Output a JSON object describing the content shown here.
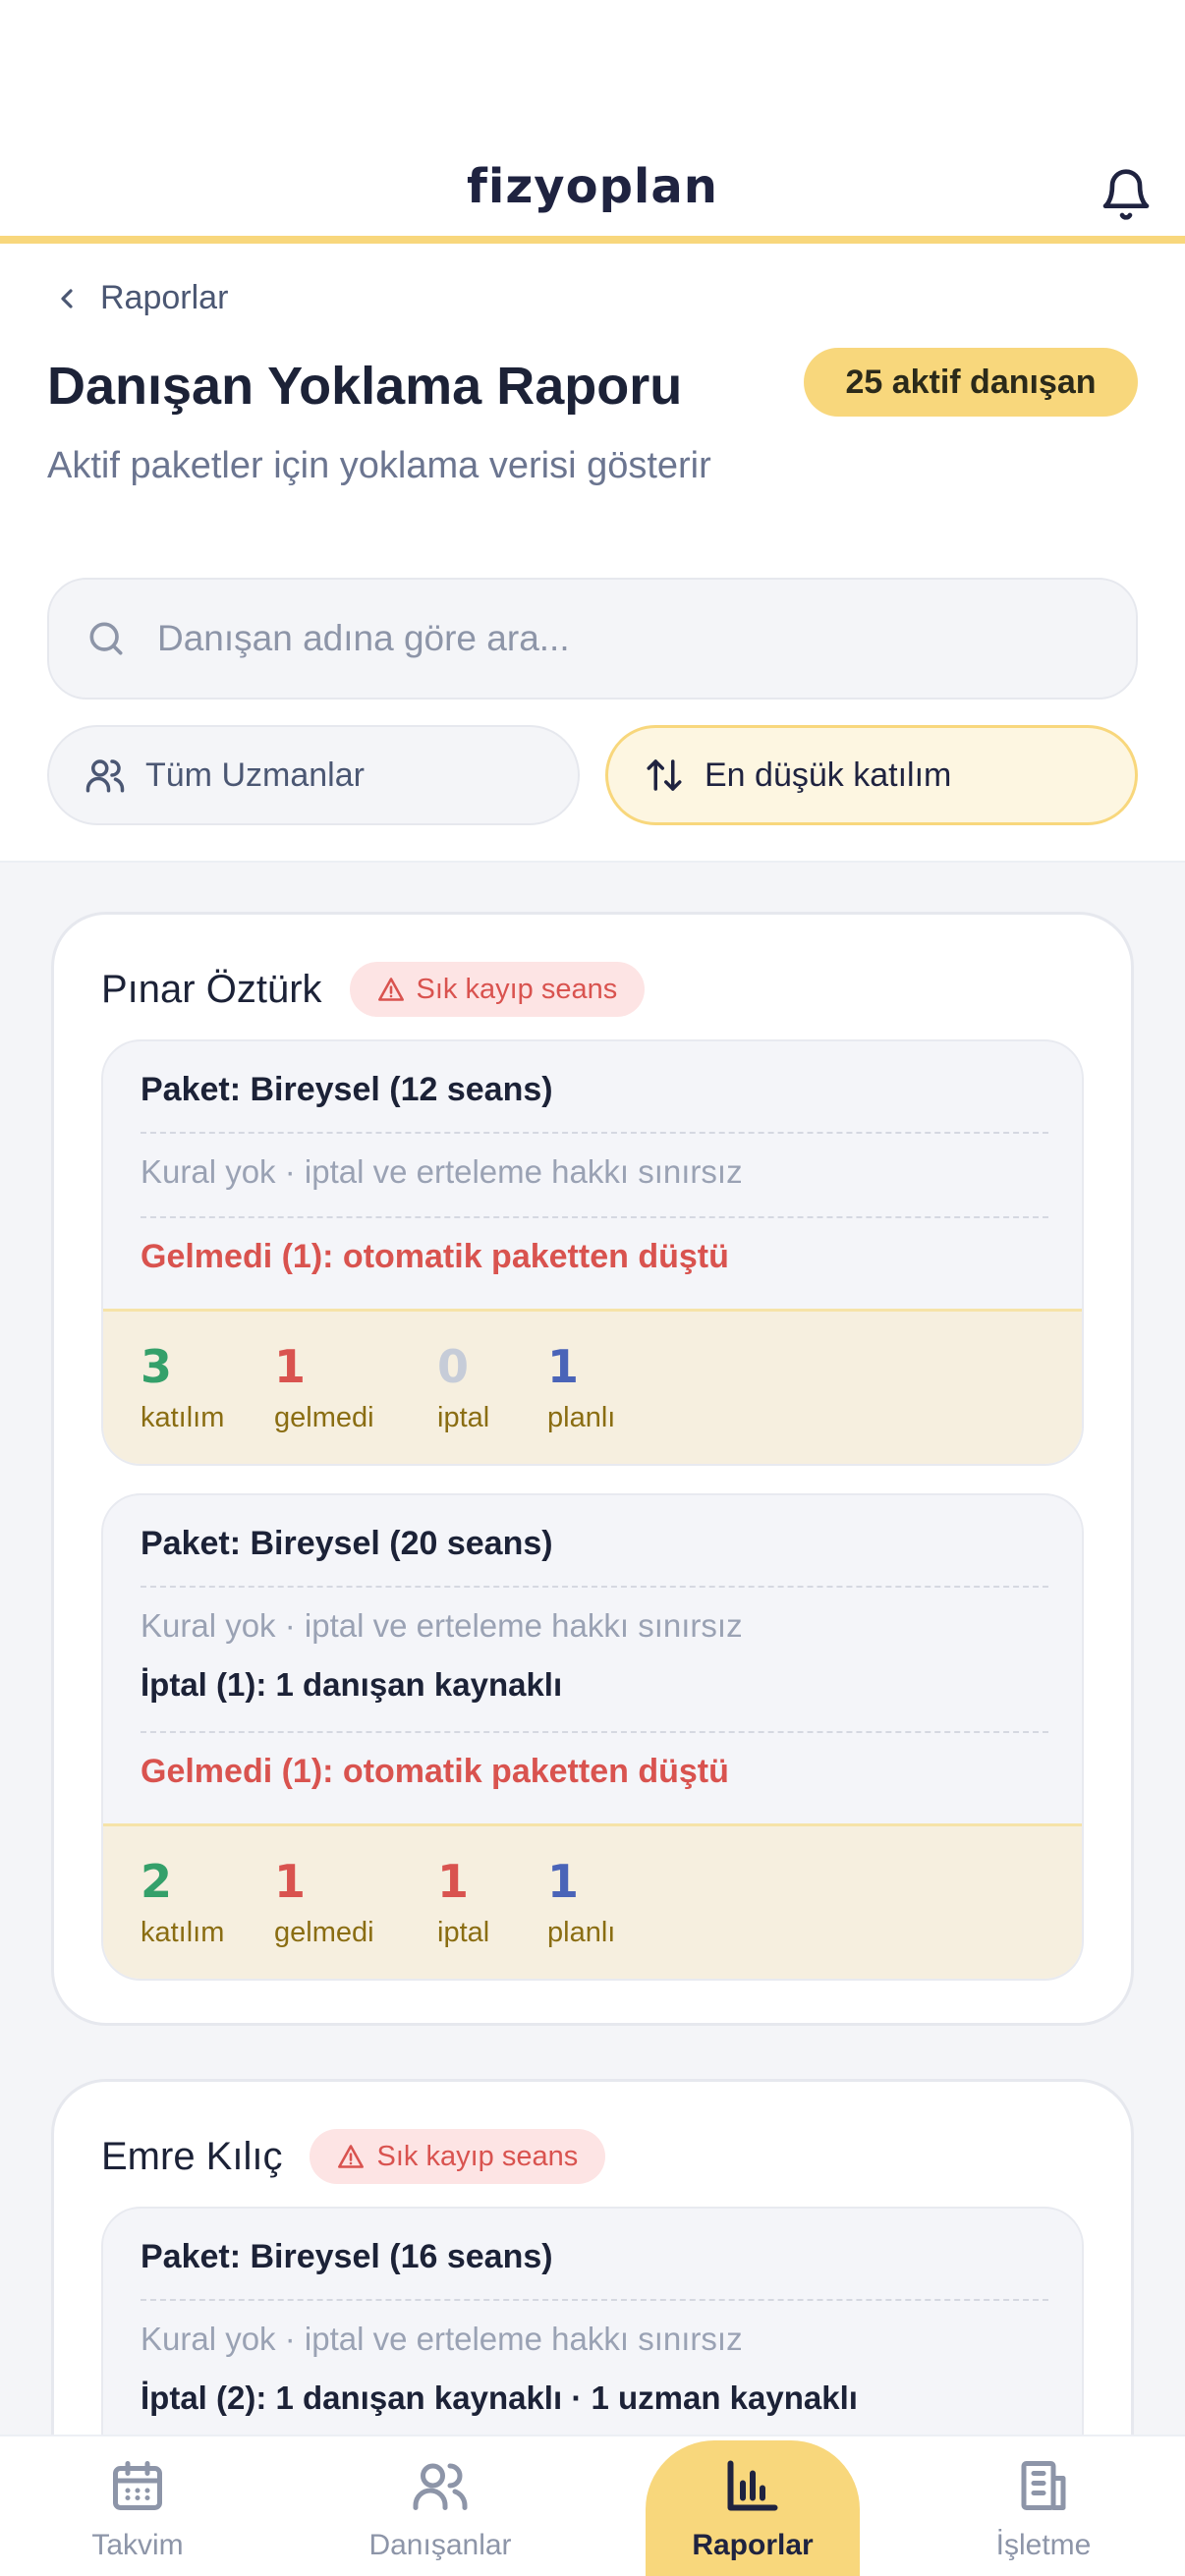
{
  "header": {
    "logo": "fizyoplan"
  },
  "top": {
    "back_label": "Raporlar",
    "title": "Danışan Yoklama Raporu",
    "active_count": "25 aktif danışan",
    "subtitle": "Aktif paketler için yoklama verisi gösterir",
    "search_placeholder": "Danışan adına göre ara...",
    "filter_expert": "Tüm Uzmanlar",
    "filter_sort": "En düşük katılım"
  },
  "clients": [
    {
      "name": "Pınar Öztürk",
      "badge": "Sık kayıp seans",
      "packages": [
        {
          "title": "Paket: Bireysel (12 seans)",
          "rule": "Kural yok · iptal ve erteleme hakkı sınırsız",
          "noshow": "Gelmedi (1): otomatik paketten düştü",
          "stats": {
            "attended": "3",
            "noshow": "1",
            "cancel": "0",
            "planned": "1"
          }
        },
        {
          "title": "Paket: Bireysel (20 seans)",
          "rule": "Kural yok · iptal ve erteleme hakkı sınırsız",
          "cancel": "İptal (1): 1 danışan kaynaklı",
          "noshow": "Gelmedi (1): otomatik paketten düştü",
          "stats": {
            "attended": "2",
            "noshow": "1",
            "cancel": "1",
            "planned": "1"
          }
        }
      ]
    },
    {
      "name": "Emre Kılıç",
      "badge": "Sık kayıp seans",
      "packages": [
        {
          "title": "Paket: Bireysel (16 seans)",
          "rule": "Kural yok · iptal ve erteleme hakkı sınırsız",
          "cancel": "İptal (2): 1 danışan kaynaklı · 1 uzman kaynaklı"
        }
      ]
    }
  ],
  "stat_labels": {
    "attended": "katılım",
    "noshow": "gelmedi",
    "cancel": "iptal",
    "planned": "planlı"
  },
  "nav": {
    "calendar": "Takvim",
    "clients": "Danışanlar",
    "reports": "Raporlar",
    "business": "İşletme"
  },
  "colors": {
    "accent": "#f8d77c",
    "danger": "#d9534f",
    "success": "#34a06a",
    "info": "#4a64b8"
  }
}
